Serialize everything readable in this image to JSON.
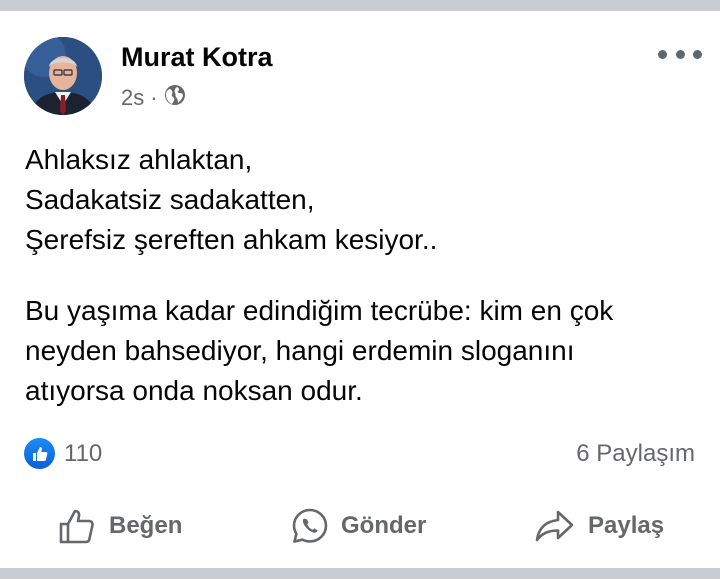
{
  "post": {
    "author": "Murat Kotra",
    "time": "2s",
    "separator": "·",
    "privacy_icon": "globe-icon",
    "more_icon": "more-options-icon",
    "text_lines_1": [
      "Ahlaksız ahlaktan,",
      "Sadakatsiz sadakatten,",
      "Şerefsiz şereften ahkam kesiyor.."
    ],
    "text_lines_2": [
      "Bu yaşıma kadar edindiğim tecrübe: kim en çok",
      "neyden bahsediyor, hangi erdemin sloganını",
      "atıyorsa onda noksan odur."
    ],
    "reactions": {
      "icon": "like-icon",
      "count": "110",
      "color": "#1877f2"
    },
    "shares": "6 Paylaşım"
  },
  "actions": {
    "like_label": "Beğen",
    "send_label": "Gönder",
    "share_label": "Paylaş"
  }
}
